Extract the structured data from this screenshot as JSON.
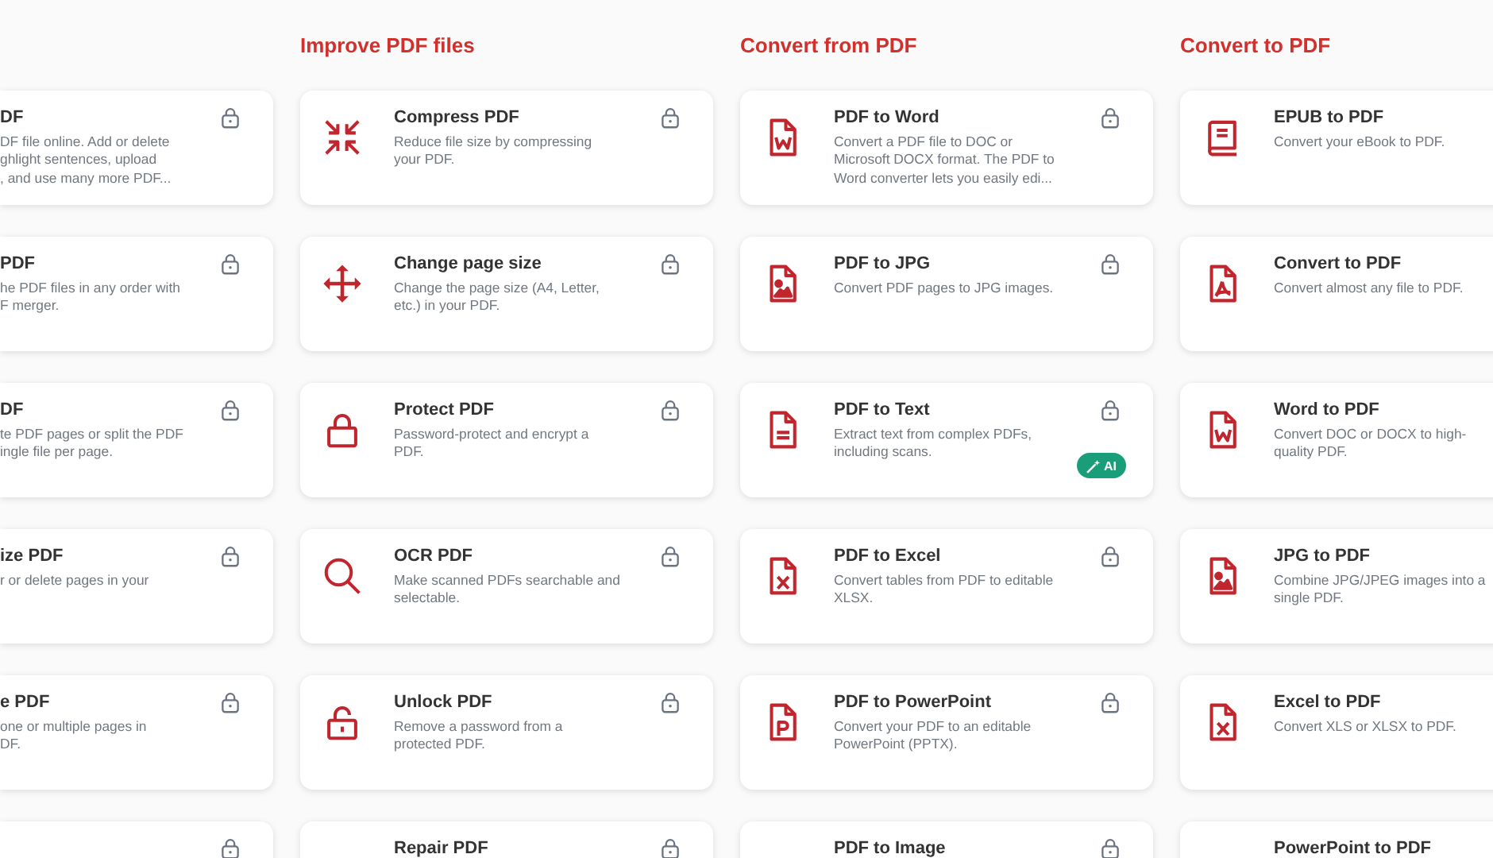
{
  "columns": [
    {
      "cards": [
        {
          "title": "DF",
          "description": "DF file online. Add or delete\nghlight sentences, upload\n, and use many more PDF...",
          "locked": true
        },
        {
          "title": "PDF",
          "description": "he PDF files in any order with\nF merger.",
          "locked": true
        },
        {
          "title": "DF",
          "description": "te PDF pages or split the PDF\ningle file per page.",
          "locked": true
        },
        {
          "title": "ize PDF",
          "description": "r or delete pages in your",
          "locked": true
        },
        {
          "title": "e PDF",
          "description": "one or multiple pages in\nDF.",
          "locked": true
        },
        {
          "locked": true
        }
      ]
    },
    {
      "heading": "Improve PDF files",
      "cards": [
        {
          "kind": "compress",
          "title": "Compress PDF",
          "description": "Reduce file size by compressing\nyour PDF.",
          "locked": true
        },
        {
          "kind": "move",
          "title": "Change page size",
          "description": "Change the page size (A4, Letter,\netc.) in your PDF.",
          "locked": true
        },
        {
          "kind": "lock",
          "title": "Protect PDF",
          "description": "Password-protect and encrypt a\nPDF.",
          "locked": true
        },
        {
          "kind": "search",
          "title": "OCR PDF",
          "description": "Make scanned PDFs searchable and\nselectable.",
          "locked": true
        },
        {
          "kind": "unlock",
          "title": "Unlock PDF",
          "description": "Remove a password from a\nprotected PDF.",
          "locked": true
        },
        {
          "title": "Repair PDF",
          "locked": true
        }
      ]
    },
    {
      "heading": "Convert from PDF",
      "cards": [
        {
          "kind": "word",
          "title": "PDF to Word",
          "description": "Convert a PDF file to DOC or\nMicrosoft DOCX format. The PDF to\nWord converter lets you easily edi...",
          "locked": true
        },
        {
          "kind": "image",
          "title": "PDF to JPG",
          "description": "Convert PDF pages to JPG images.",
          "locked": true
        },
        {
          "kind": "text",
          "title": "PDF to Text",
          "description": "Extract text from complex PDFs,\nincluding scans.",
          "locked": true,
          "badge": "AI"
        },
        {
          "kind": "excel",
          "title": "PDF to Excel",
          "description": "Convert tables from PDF to editable\nXLSX.",
          "locked": true
        },
        {
          "kind": "ppt",
          "title": "PDF to PowerPoint",
          "description": "Convert your PDF to an editable\nPowerPoint (PPTX).",
          "locked": true
        },
        {
          "title": "PDF to Image",
          "locked": true
        }
      ]
    },
    {
      "heading": "Convert to PDF",
      "cards": [
        {
          "kind": "book",
          "title": "EPUB to PDF",
          "description": "Convert your eBook to PDF."
        },
        {
          "kind": "acrobat",
          "title": "Convert to PDF",
          "description": "Convert almost any file to PDF."
        },
        {
          "kind": "word",
          "title": "Word to PDF",
          "description": "Convert DOC or DOCX to high-\nquality PDF."
        },
        {
          "kind": "image",
          "title": "JPG to PDF",
          "description": "Combine JPG/JPEG images into a\nsingle PDF."
        },
        {
          "kind": "excel",
          "title": "Excel to PDF",
          "description": "Convert XLS or XLSX to PDF."
        },
        {
          "title": "PowerPoint to PDF"
        }
      ]
    }
  ]
}
